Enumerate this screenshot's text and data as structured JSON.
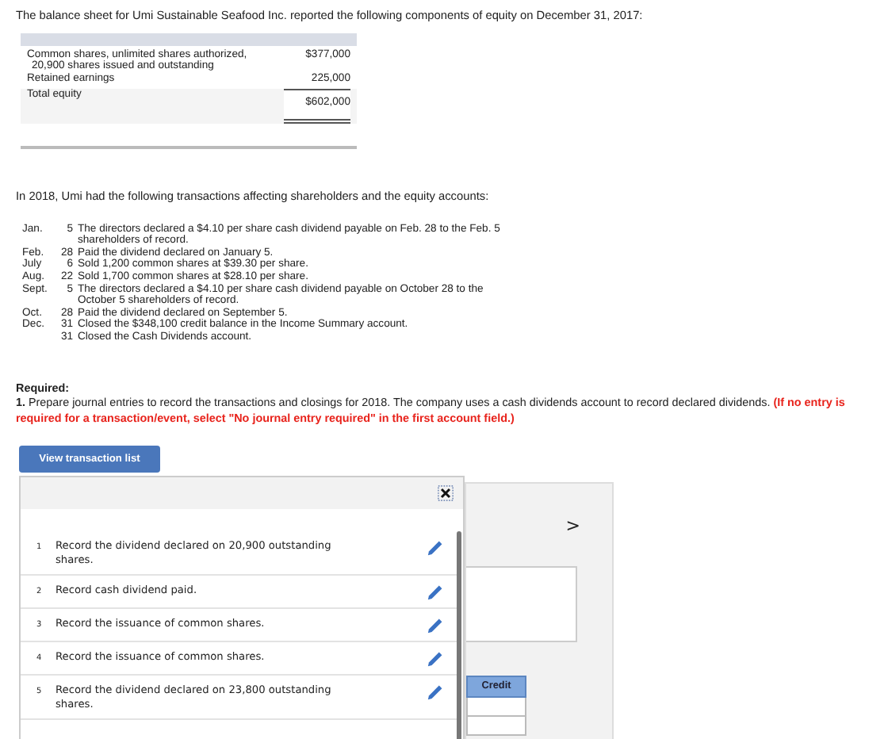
{
  "intro": "The balance sheet for Umi Sustainable Seafood Inc. reported the following components of equity on December 31, 2017:",
  "equity_table": {
    "rows": [
      {
        "kind": "item",
        "label": [
          "Common shares, unlimited shares authorized,",
          "20,900 shares issued and outstanding"
        ],
        "amount": "$377,000"
      },
      {
        "kind": "item",
        "label": [
          "Retained earnings"
        ],
        "amount": "225,000"
      },
      {
        "kind": "total",
        "label": [
          "Total equity"
        ],
        "amount": "$602,000"
      }
    ]
  },
  "transactions_intro": "In 2018, Umi had the following transactions affecting shareholders and the equity accounts:",
  "transactions": [
    {
      "month": "Jan.",
      "day": "5",
      "text": "The directors declared a $4.10 per share cash dividend payable on Feb. 28 to the Feb. 5 shareholders of record."
    },
    {
      "month": "Feb.",
      "day": "28",
      "text": "Paid the dividend declared on January 5."
    },
    {
      "month": "July",
      "day": "6",
      "text": "Sold 1,200 common shares at $39.30 per share."
    },
    {
      "month": "Aug.",
      "day": "22",
      "text": "Sold 1,700 common shares at $28.10 per share."
    },
    {
      "month": "Sept.",
      "day": "5",
      "text": "The directors declared a $4.10 per share cash dividend payable on October 28 to the October 5 shareholders of record."
    },
    {
      "month": "Oct.",
      "day": "28",
      "text": "Paid the dividend declared on September 5."
    },
    {
      "month": "Dec.",
      "day": "31",
      "text": "Closed the $348,100 credit balance in the Income Summary account."
    },
    {
      "day": "31",
      "text": "Closed the Cash Dividends account."
    }
  ],
  "required": {
    "heading": "Required:",
    "instruction": "**1.** Prepare journal entries to record the transactions and closings for 2018. The company uses a cash dividends account to record declared dividends.",
    "note": "(If no entry is required for a transaction/event, select \"No journal entry required\" in the first account field.)"
  },
  "view_button": "View transaction list",
  "transaction_list": [
    {
      "number": "1",
      "text": "Record the dividend declared on 20,900 outstanding shares."
    },
    {
      "number": "2",
      "text": "Record cash dividend paid."
    },
    {
      "number": "3",
      "text": "Record the issuance of common shares."
    },
    {
      "number": "4",
      "text": "Record the issuance of common shares."
    },
    {
      "number": "5",
      "text": "Record the dividend declared on 23,800 outstanding shares."
    }
  ],
  "journal": {
    "next": ">",
    "credit_header": "Credit"
  }
}
